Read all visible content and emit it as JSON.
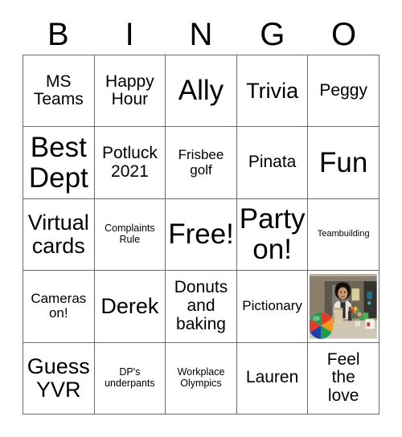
{
  "header": {
    "letters": [
      "B",
      "I",
      "N",
      "G",
      "O"
    ]
  },
  "grid": {
    "rows": [
      [
        {
          "text": "MS\nTeams",
          "size": "sz-md"
        },
        {
          "text": "Happy\nHour",
          "size": "sz-md"
        },
        {
          "text": "Ally",
          "size": "sz-xl"
        },
        {
          "text": "Trivia",
          "size": "sz-lg"
        },
        {
          "text": "Peggy",
          "size": "sz-md"
        }
      ],
      [
        {
          "text": "Best\nDept",
          "size": "sz-xl"
        },
        {
          "text": "Potluck\n2021",
          "size": "sz-md"
        },
        {
          "text": "Frisbee\ngolf",
          "size": "sz-sm"
        },
        {
          "text": "Pinata",
          "size": "sz-md"
        },
        {
          "text": "Fun",
          "size": "sz-xl"
        }
      ],
      [
        {
          "text": "Virtual\ncards",
          "size": "sz-lg"
        },
        {
          "text": "Complaints\nRule",
          "size": "sz-xs"
        },
        {
          "text": "Free!",
          "size": "sz-xl"
        },
        {
          "text": "Party\non!",
          "size": "sz-xl"
        },
        {
          "text": "Teambuilding",
          "size": "sz-xxs"
        }
      ],
      [
        {
          "text": "Cameras\non!",
          "size": "sz-sm"
        },
        {
          "text": "Derek",
          "size": "sz-lg"
        },
        {
          "text": "Donuts\nand\nbaking",
          "size": "sz-md"
        },
        {
          "text": "Pictionary",
          "size": "sz-sm"
        },
        {
          "type": "photo",
          "alt": "woman-at-party-table-with-beach-ball"
        }
      ],
      [
        {
          "text": "Guess\nYVR",
          "size": "sz-lg"
        },
        {
          "text": "DP's\nunderpants",
          "size": "sz-xs"
        },
        {
          "text": "Workplace\nOlympics",
          "size": "sz-xs"
        },
        {
          "text": "Lauren",
          "size": "sz-md"
        },
        {
          "text": "Feel\nthe\nlove",
          "size": "sz-md"
        }
      ]
    ]
  },
  "colors": {
    "background": "#ffffff",
    "border": "#6b6b6b",
    "text": "#000000"
  }
}
